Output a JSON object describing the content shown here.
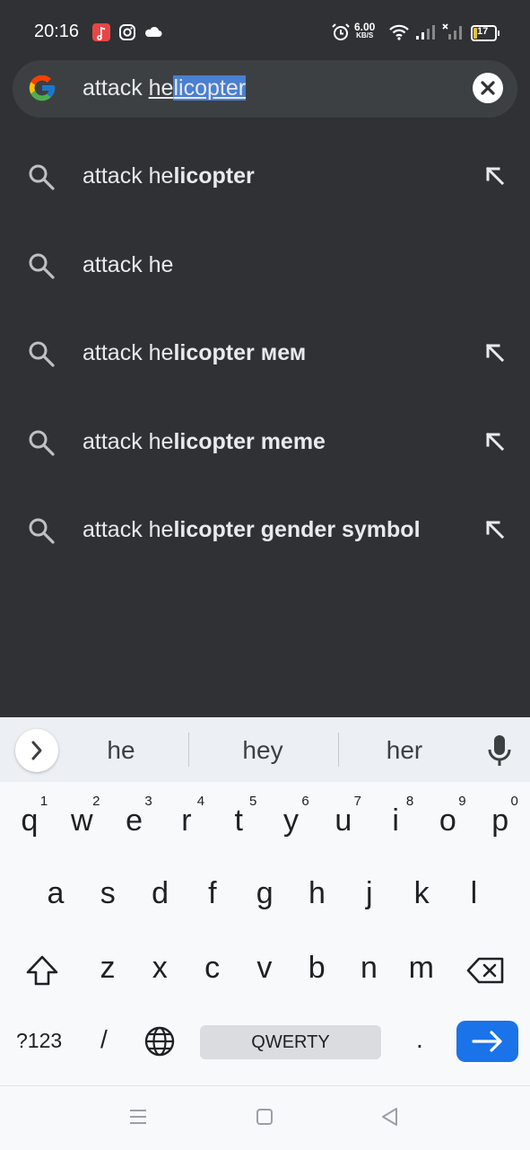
{
  "status_bar": {
    "time": "20:16",
    "speed_value": "6.00",
    "speed_unit": "KB/S",
    "battery": "17",
    "icons": [
      "music-icon",
      "instagram-icon",
      "cloud-icon",
      "alarm-icon",
      "wifi-icon",
      "signal-icon",
      "signal-x-icon",
      "battery-icon"
    ]
  },
  "search": {
    "query_plain": "attack ",
    "query_underlined": "he",
    "query_selected": "licopter",
    "logo": "google-logo",
    "clear_icon": "clear-icon"
  },
  "suggestions": [
    {
      "prefix": "attack he",
      "bold": "licopter",
      "fill_icon": true
    },
    {
      "prefix": "attack he",
      "bold": "",
      "fill_icon": false
    },
    {
      "prefix": "attack he",
      "bold": "licopter мем",
      "fill_icon": true
    },
    {
      "prefix": "attack he",
      "bold": "licopter meme",
      "fill_icon": true
    },
    {
      "prefix": "attack he",
      "bold": "licopter gender symbol",
      "fill_icon": true
    }
  ],
  "keyboard": {
    "word_suggestions": [
      "he",
      "hey",
      "her"
    ],
    "row1": [
      "q",
      "w",
      "e",
      "r",
      "t",
      "y",
      "u",
      "i",
      "o",
      "p"
    ],
    "row1_hints": [
      "1",
      "2",
      "3",
      "4",
      "5",
      "6",
      "7",
      "8",
      "9",
      "0"
    ],
    "row2": [
      "a",
      "s",
      "d",
      "f",
      "g",
      "h",
      "j",
      "k",
      "l"
    ],
    "row3": [
      "z",
      "x",
      "c",
      "v",
      "b",
      "n",
      "m"
    ],
    "symbols_label": "?123",
    "slash": "/",
    "space_label": "QWERTY",
    "period": "."
  },
  "colors": {
    "background": "#303134",
    "search_field": "#3c4043",
    "selection": "#4a7fd1",
    "enter_key": "#1a73e8"
  }
}
